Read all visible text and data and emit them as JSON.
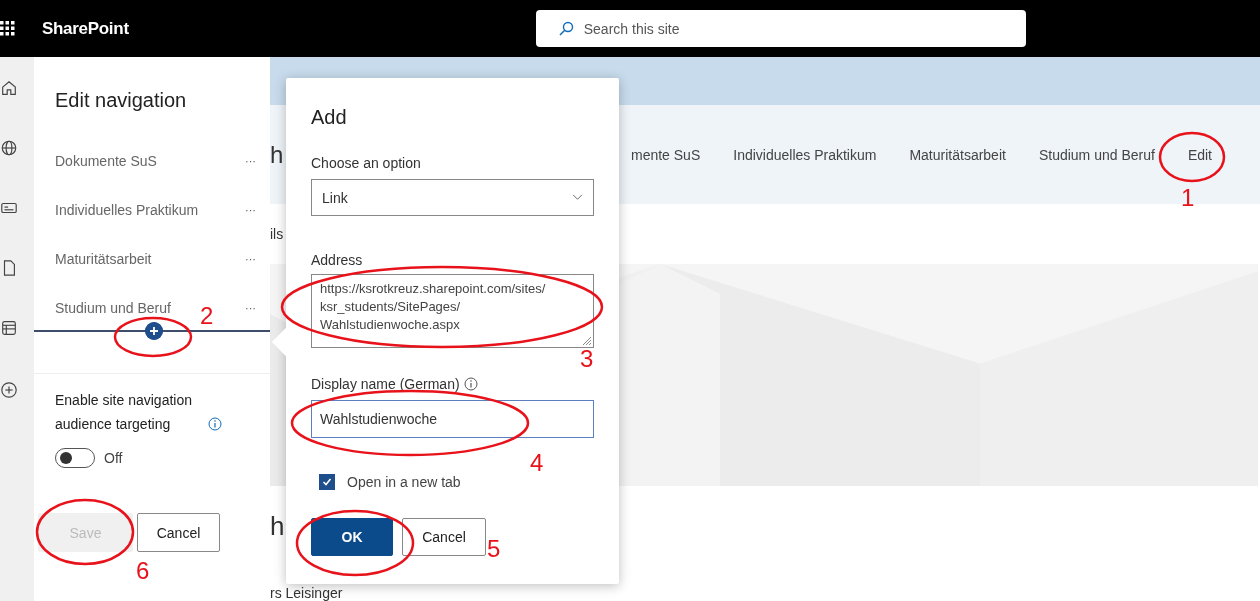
{
  "top_bar": {
    "app_name": "SharePoint",
    "search": {
      "placeholder": "Search this site"
    }
  },
  "edit_navigation": {
    "title": "Edit navigation",
    "items": [
      {
        "label": "Dokumente SuS",
        "more": "···"
      },
      {
        "label": "Individuelles Praktikum",
        "more": "···"
      },
      {
        "label": "Maturitätsarbeit",
        "more": "···"
      },
      {
        "label": "Studium und Beruf",
        "more": "···"
      }
    ],
    "audience_targeting": {
      "label": "Enable site navigation audience targeting",
      "on": false,
      "state_text": "Off"
    },
    "buttons": [
      {
        "label": "Save",
        "disabled": true
      },
      {
        "label": "Cancel",
        "disabled": false
      }
    ]
  },
  "page_behind": {
    "title_fragment": "h",
    "nav_links": [
      "mente SuS",
      "Individuelles Praktikum",
      "Maturitätsarbeit",
      "Studium und Beruf",
      "Edit"
    ],
    "subtitle_fragment": "ils",
    "heading_fragment": "h",
    "author_fragment": "rs Leisinger"
  },
  "add_dialog": {
    "title": "Add",
    "option": {
      "label": "Choose an option",
      "value": "Link"
    },
    "address": {
      "label": "Address",
      "value_lines": [
        "https://ksrotkreuz.sharepoint.com/sites/",
        "ksr_students/SitePages/",
        "Wahlstudienwoche.aspx"
      ]
    },
    "display_name": {
      "label": "Display name (German)",
      "value": "Wahlstudienwoche"
    },
    "open_new_tab": {
      "label": "Open in a new tab",
      "checked": true
    },
    "buttons": [
      {
        "label": "OK",
        "primary": true
      },
      {
        "label": "Cancel",
        "primary": false
      }
    ]
  },
  "annotations": [
    {
      "number": "1"
    },
    {
      "number": "2"
    },
    {
      "number": "3"
    },
    {
      "number": "4"
    },
    {
      "number": "5"
    },
    {
      "number": "6"
    }
  ]
}
